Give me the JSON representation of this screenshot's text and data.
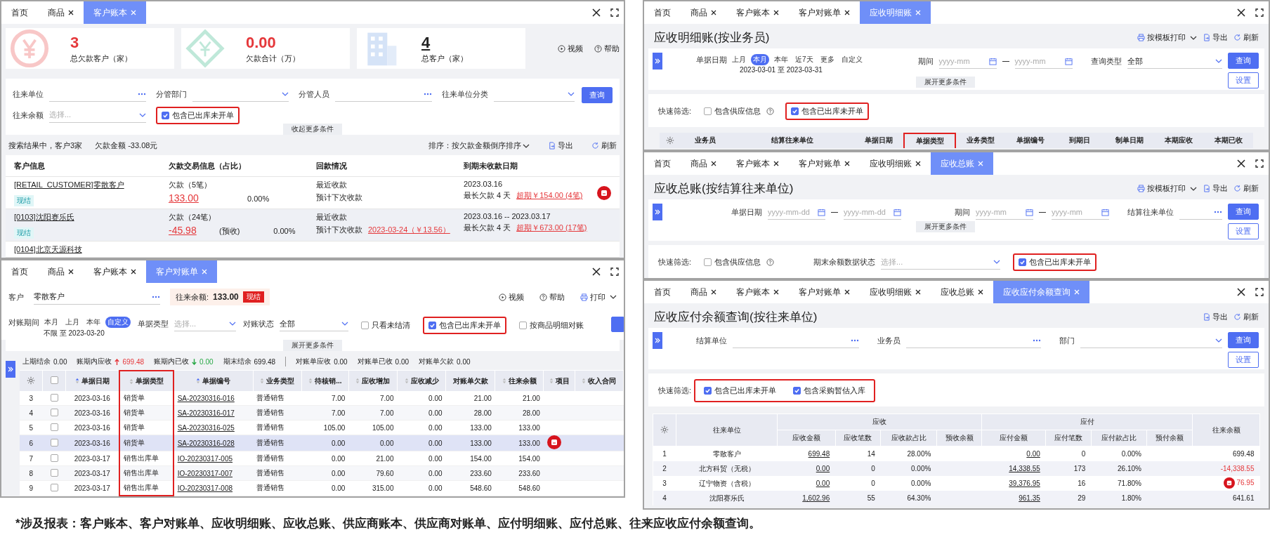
{
  "left_column": [
    {
      "kind": "ledger",
      "tabs": [
        {
          "label": "首页",
          "closable": false,
          "selected": false
        },
        {
          "label": "商品",
          "closable": true,
          "selected": false
        },
        {
          "label": "客户账本",
          "closable": true,
          "selected": true
        }
      ],
      "stats": [
        {
          "value": "3",
          "label": "总欠款客户（家）",
          "kind": "debtors"
        },
        {
          "value": "0.00",
          "label": "欠款合计（万）",
          "kind": "amount"
        },
        {
          "value": "4",
          "label": "总客户（家）",
          "kind": "customers"
        }
      ],
      "actions": [
        {
          "label": "视频",
          "kind": "video"
        },
        {
          "label": "帮助",
          "kind": "help"
        }
      ],
      "filters": [
        {
          "label": "往来单位",
          "kind": "picker"
        },
        {
          "label": "分管部门",
          "kind": "select"
        },
        {
          "label": "分管人员",
          "kind": "picker"
        },
        {
          "label": "往来单位分类",
          "kind": "select"
        },
        {
          "label": "往来余额",
          "kind": "select",
          "placeholder": "选择..."
        }
      ],
      "checkbox": {
        "label": "包含已出库未开单",
        "checked": true,
        "highlighted": true
      },
      "query_button": "查询",
      "toggle": "收起更多条件",
      "summary": [
        "搜索结果中，客户3家",
        "欠款金额 -33.08元"
      ],
      "sort": "排序：按欠款金额倒序排序",
      "tools": [
        {
          "label": "导出",
          "kind": "export"
        },
        {
          "label": "刷新",
          "kind": "refresh"
        }
      ],
      "columns": [
        "客户信息",
        "欠款交易信息（占比）",
        "回款情况",
        "到期未收款日期"
      ],
      "rows": [
        {
          "name": "[RETAIL_CUSTOMER]零散客户",
          "tag": "现结",
          "debt": "欠款（5笔）",
          "amount": "133.00",
          "share": "0.00%",
          "recent": "最近收款",
          "next": "预计下次收款",
          "date": "2023.03.16",
          "longest": "最长欠款 4 天",
          "overdue": "超期￥154.00 (4笔)",
          "selected": false,
          "marker": true
        },
        {
          "name": "[0103]沈阳赛乐氏",
          "tag": "现结",
          "debt": "欠款（24笔）",
          "amount": "-45.98",
          "amount_note": "(预收)",
          "share": "0.00%",
          "recent": "最近收款",
          "next": "预计下次收款",
          "next_link": "2023-03-24（￥13.56）",
          "date": "2023.03.16 -- 2023.03.17",
          "longest": "最长欠款 4 天",
          "overdue": "超期￥673.00 (17笔)",
          "selected": true,
          "marker": false
        },
        {
          "name": "[0104]北京天源科技",
          "selected": false,
          "marker": false
        }
      ]
    },
    {
      "kind": "statement",
      "tabs": [
        {
          "label": "首页",
          "closable": false,
          "selected": false
        },
        {
          "label": "商品",
          "closable": true,
          "selected": false
        },
        {
          "label": "客户账本",
          "closable": true,
          "selected": false
        },
        {
          "label": "客户对账单",
          "closable": true,
          "selected": true
        }
      ],
      "customer": {
        "label": "客户",
        "value": "零散客户"
      },
      "balance": {
        "label": "往来余额:",
        "value": "133.00",
        "tag": "现结"
      },
      "actions": [
        {
          "label": "视频",
          "kind": "video",
          "dropdown": false
        },
        {
          "label": "帮助",
          "kind": "help",
          "dropdown": false
        },
        {
          "label": "打印",
          "kind": "print",
          "dropdown": true
        }
      ],
      "period": {
        "label": "对账期间",
        "options": [
          {
            "label": "本月",
            "selected": false
          },
          {
            "label": "上月",
            "selected": false
          },
          {
            "label": "本年",
            "selected": false
          },
          {
            "label": "自定义",
            "selected": true
          }
        ],
        "range": "不限 至 2023-03-20"
      },
      "filters": [
        {
          "label": "单据类型",
          "kind": "select",
          "placeholder": "选择..."
        },
        {
          "label": "对账状态",
          "kind": "select",
          "value": "全部"
        }
      ],
      "checkboxes": [
        {
          "label": "只看未结清",
          "checked": false,
          "highlighted": false
        },
        {
          "label": "包含已出库未开单",
          "checked": true,
          "highlighted": true
        },
        {
          "label": "按商品明细对账",
          "checked": false,
          "highlighted": false
        }
      ],
      "query_button": true,
      "toggle": "展开更多条件",
      "totals": [
        {
          "label": "上期结余",
          "value": "0.00",
          "kind": "plain"
        },
        {
          "label": "账期内应收",
          "value": "699.48",
          "kind": "up"
        },
        {
          "label": "账期内已收",
          "value": "0.00",
          "kind": "down"
        },
        {
          "label": "期末结余",
          "value": "699.48",
          "kind": "plain"
        }
      ],
      "statement_totals": [
        {
          "label": "对账单应收",
          "value": "0.00"
        },
        {
          "label": "对账单已收",
          "value": "0.00"
        },
        {
          "label": "对账单欠款",
          "value": "0.00"
        }
      ],
      "select_all_checked": false,
      "columns": [
        {
          "label": "单据日期",
          "kind": "sort_active",
          "highlighted": false
        },
        {
          "label": "单据类型",
          "kind": "sortable",
          "highlighted": true
        },
        {
          "label": "单据编号",
          "kind": "sort_active",
          "highlighted": false
        },
        {
          "label": "业务类型",
          "kind": "sortable",
          "highlighted": false
        },
        {
          "label": "待核销...",
          "kind": "sortable",
          "highlighted": false
        },
        {
          "label": "应收增加",
          "kind": "sortable",
          "highlighted": false
        },
        {
          "label": "应收减少",
          "kind": "sortable",
          "highlighted": false
        },
        {
          "label": "对账单欠款",
          "kind": "plain",
          "highlighted": false
        },
        {
          "label": "往来余额",
          "kind": "sortable",
          "highlighted": false
        },
        {
          "label": "项目",
          "kind": "sortable",
          "highlighted": false
        },
        {
          "label": "收入合同",
          "kind": "sortable",
          "highlighted": false
        }
      ],
      "rows": [
        {
          "no": "3",
          "checked": false,
          "date": "2023-03-16",
          "type": "销货单",
          "number": "SA-20230316-016",
          "business": "普通销售",
          "pending": "7.00",
          "increase": "7.00",
          "decrease": "0.00",
          "owed": "21.00",
          "balance": "21.00",
          "selected": false,
          "marker": false
        },
        {
          "no": "4",
          "checked": false,
          "date": "2023-03-16",
          "type": "销货单",
          "number": "SA-20230316-017",
          "business": "普通销售",
          "pending": "7.00",
          "increase": "7.00",
          "decrease": "0.00",
          "owed": "28.00",
          "balance": "28.00",
          "selected": false,
          "marker": false
        },
        {
          "no": "5",
          "checked": false,
          "date": "2023-03-16",
          "type": "销货单",
          "number": "SA-20230316-025",
          "business": "普通销售",
          "pending": "105.00",
          "increase": "105.00",
          "decrease": "0.00",
          "owed": "133.00",
          "balance": "133.00",
          "selected": false,
          "marker": false
        },
        {
          "no": "6",
          "checked": false,
          "date": "2023-03-16",
          "type": "销货单",
          "number": "SA-20230316-028",
          "business": "普通销售",
          "pending": "0.00",
          "increase": "0.00",
          "decrease": "0.00",
          "owed": "133.00",
          "balance": "133.00",
          "selected": true,
          "marker": true
        },
        {
          "no": "7",
          "checked": false,
          "date": "2023-03-17",
          "type": "销售出库单",
          "number": "IO-20230317-005",
          "business": "普通销售",
          "pending": "0.00",
          "increase": "21.00",
          "decrease": "0.00",
          "owed": "154.00",
          "balance": "154.00",
          "selected": false,
          "marker": false
        },
        {
          "no": "8",
          "checked": false,
          "date": "2023-03-17",
          "type": "销售出库单",
          "number": "IO-20230317-007",
          "business": "普通销售",
          "pending": "0.00",
          "increase": "79.60",
          "decrease": "0.00",
          "owed": "233.60",
          "balance": "233.60",
          "selected": false,
          "marker": false
        },
        {
          "no": "9",
          "checked": false,
          "date": "2023-03-17",
          "type": "销售出库单",
          "number": "IO-20230317-008",
          "business": "普通销售",
          "pending": "0.00",
          "increase": "315.00",
          "decrease": "0.00",
          "owed": "548.60",
          "balance": "548.60",
          "selected": false,
          "marker": false
        }
      ]
    }
  ],
  "right_column": [
    {
      "kind": "report",
      "tabs": [
        {
          "label": "首页",
          "closable": false,
          "selected": false
        },
        {
          "label": "商品",
          "closable": true,
          "selected": false
        },
        {
          "label": "客户账本",
          "closable": true,
          "selected": false
        },
        {
          "label": "客户对账单",
          "closable": true,
          "selected": false
        },
        {
          "label": "应收明细账",
          "closable": true,
          "selected": true
        }
      ],
      "title": "应收明细账(按业务员)",
      "actions": [
        {
          "label": "按模板打印",
          "kind": "print",
          "dropdown": true
        },
        {
          "label": "导出",
          "kind": "export",
          "dropdown": false
        },
        {
          "label": "刷新",
          "kind": "refresh",
          "dropdown": false
        }
      ],
      "fields": [
        {
          "kind": "chips",
          "label": "单据日期",
          "options": [
            {
              "label": "上月",
              "selected": false
            },
            {
              "label": "本月",
              "selected": true
            },
            {
              "label": "本年",
              "selected": false
            },
            {
              "label": "近7天",
              "selected": false
            },
            {
              "label": "更多",
              "selected": false
            },
            {
              "label": "自定义",
              "selected": false
            }
          ],
          "range": "2023-03-01 至 2023-03-31"
        },
        {
          "kind": "range",
          "label": "期间",
          "from": "yyyy-mm",
          "to": "yyyy-mm"
        },
        {
          "kind": "select",
          "label": "查询类型",
          "value": "全部"
        }
      ],
      "buttons": [
        {
          "label": "查询",
          "kind": "primary"
        },
        {
          "label": "设置",
          "kind": "secondary"
        }
      ],
      "toggle": "展开更多条件",
      "quick_filter": {
        "label": "快速筛选:",
        "highlighted": false,
        "items": [
          {
            "kind": "checkbox",
            "label": "包含供应信息",
            "checked": false,
            "help": true,
            "highlighted": false
          },
          {
            "kind": "checkbox",
            "label": "包含已出库未开单",
            "checked": true,
            "help": false,
            "highlighted": true
          }
        ]
      },
      "columns": [
        {
          "label": "业务员",
          "highlighted": false
        },
        {
          "label": "结算往来单位",
          "highlighted": false
        },
        {
          "label": "单据日期",
          "highlighted": false
        },
        {
          "label": "单据类型",
          "highlighted": true
        },
        {
          "label": "业务类型",
          "highlighted": false
        },
        {
          "label": "单据编号",
          "highlighted": false
        },
        {
          "label": "到期日",
          "highlighted": false
        },
        {
          "label": "制单日期",
          "highlighted": false
        },
        {
          "label": "本期应收",
          "highlighted": false
        },
        {
          "label": "本期已收",
          "highlighted": false
        }
      ]
    },
    {
      "kind": "report",
      "tabs": [
        {
          "label": "首页",
          "closable": false,
          "selected": false
        },
        {
          "label": "商品",
          "closable": true,
          "selected": false
        },
        {
          "label": "客户账本",
          "closable": true,
          "selected": false
        },
        {
          "label": "客户对账单",
          "closable": true,
          "selected": false
        },
        {
          "label": "应收明细账",
          "closable": true,
          "selected": false
        },
        {
          "label": "应收总账",
          "closable": true,
          "selected": true
        }
      ],
      "title": "应收总账(按结算往来单位)",
      "actions": [
        {
          "label": "按模板打印",
          "kind": "print",
          "dropdown": true
        },
        {
          "label": "导出",
          "kind": "export",
          "dropdown": false
        },
        {
          "label": "刷新",
          "kind": "refresh",
          "dropdown": false
        }
      ],
      "fields": [
        {
          "kind": "range",
          "label": "单据日期",
          "from": "yyyy-mm-dd",
          "to": "yyyy-mm-dd"
        },
        {
          "kind": "range",
          "label": "期间",
          "from": "yyyy-mm",
          "to": "yyyy-mm"
        },
        {
          "kind": "picker",
          "label": "结算往来单位"
        }
      ],
      "buttons": [
        {
          "label": "查询",
          "kind": "primary"
        },
        {
          "label": "设置",
          "kind": "secondary"
        }
      ],
      "toggle": "展开更多条件",
      "quick_filter": {
        "label": "快速筛选:",
        "highlighted": false,
        "items": [
          {
            "kind": "checkbox",
            "label": "包含供应信息",
            "checked": false,
            "help": true,
            "highlighted": false
          },
          {
            "kind": "select",
            "label": "期末余额数据状态",
            "placeholder": "选择..."
          },
          {
            "kind": "checkbox",
            "label": "包含已出库未开单",
            "checked": true,
            "help": false,
            "highlighted": true
          }
        ]
      }
    },
    {
      "kind": "report",
      "tabs": [
        {
          "label": "首页",
          "closable": false,
          "selected": false
        },
        {
          "label": "商品",
          "closable": true,
          "selected": false
        },
        {
          "label": "客户账本",
          "closable": true,
          "selected": false
        },
        {
          "label": "客户对账单",
          "closable": true,
          "selected": false
        },
        {
          "label": "应收明细账",
          "closable": true,
          "selected": false
        },
        {
          "label": "应收总账",
          "closable": true,
          "selected": false
        },
        {
          "label": "应收应付余额查询",
          "closable": true,
          "selected": true
        }
      ],
      "title": "应收应付余额查询(按往来单位)",
      "actions": [
        {
          "label": "导出",
          "kind": "export",
          "dropdown": false
        },
        {
          "label": "刷新",
          "kind": "refresh",
          "dropdown": false
        }
      ],
      "fields": [
        {
          "kind": "picker",
          "label": "结算单位"
        },
        {
          "kind": "picker",
          "label": "业务员"
        },
        {
          "kind": "select",
          "label": "部门"
        }
      ],
      "buttons": [
        {
          "label": "查询",
          "kind": "primary"
        },
        {
          "label": "设置",
          "kind": "secondary"
        }
      ],
      "quick_filter": {
        "label": "快速筛选:",
        "highlighted": true,
        "items": [
          {
            "kind": "checkbox",
            "label": "包含已出库未开单",
            "checked": true,
            "help": false,
            "highlighted": false
          },
          {
            "kind": "checkbox",
            "label": "包含采购暂估入库",
            "checked": true,
            "help": false,
            "highlighted": false
          }
        ]
      },
      "balance_table": {
        "lead_column": "往来单位",
        "tail_column": "往来余额",
        "groups": [
          {
            "label": "应收",
            "columns": [
              "应收金额",
              "应收笔数",
              "应收款占比",
              "预收余额"
            ]
          },
          {
            "label": "应付",
            "columns": [
              "应付金额",
              "应付笔数",
              "应付款占比",
              "预付余额"
            ]
          }
        ],
        "rows": [
          {
            "no": "1",
            "name": "零散客户",
            "receivable_amount": "699.48",
            "receivable_count": "14",
            "receivable_share": "28.00%",
            "payable_amount": "0.00",
            "payable_count": "0",
            "payable_share": "0.00%",
            "balance": "699.48",
            "negative": false,
            "selected": false,
            "marker": false
          },
          {
            "no": "2",
            "name": "北方科贸（无税）",
            "receivable_amount": "0.00",
            "receivable_count": "0",
            "receivable_share": "0.00%",
            "payable_amount": "14,338.55",
            "payable_count": "173",
            "payable_share": "26.10%",
            "balance": "-14,338.55",
            "negative": true,
            "selected": true,
            "marker": false
          },
          {
            "no": "3",
            "name": "辽宁物资（含税）",
            "receivable_amount": "0.00",
            "receivable_count": "0",
            "receivable_share": "0.00%",
            "payable_amount": "39,376.95",
            "payable_count": "16",
            "payable_share": "71.80%",
            "balance": "76.95",
            "negative": true,
            "selected": false,
            "marker": true
          },
          {
            "no": "4",
            "name": "沈阳赛乐氏",
            "receivable_amount": "1,602.96",
            "receivable_count": "55",
            "receivable_share": "64.30%",
            "payable_amount": "961.35",
            "payable_count": "29",
            "payable_share": "1.80%",
            "balance": "641.61",
            "negative": false,
            "selected": true,
            "marker": false
          }
        ]
      }
    }
  ],
  "footnote": "*涉及报表：客户账本、客户对账单、应收明细账、应收总账、供应商账本、供应商对账单、应付明细账、应付总账、往来应收应付余额查询。"
}
